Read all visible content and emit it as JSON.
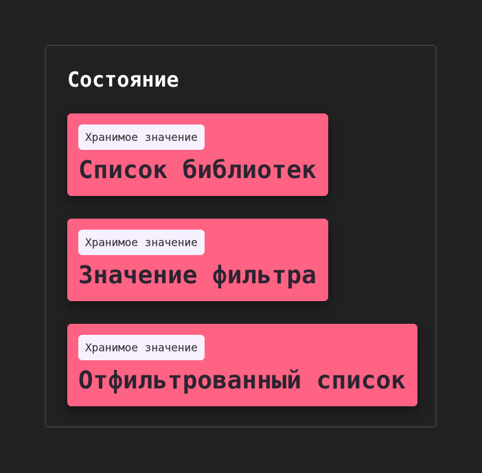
{
  "panel": {
    "title": "Состояние",
    "cards": [
      {
        "tag": "Хранимое значение",
        "title": "Список библиотек"
      },
      {
        "tag": "Хранимое значение",
        "title": "Значение фильтра"
      },
      {
        "tag": "Хранимое значение",
        "title": "Отфильтрованный список"
      }
    ]
  },
  "colors": {
    "background": "#212121",
    "card": "#ff6384",
    "tag": "#f7f0ff"
  }
}
